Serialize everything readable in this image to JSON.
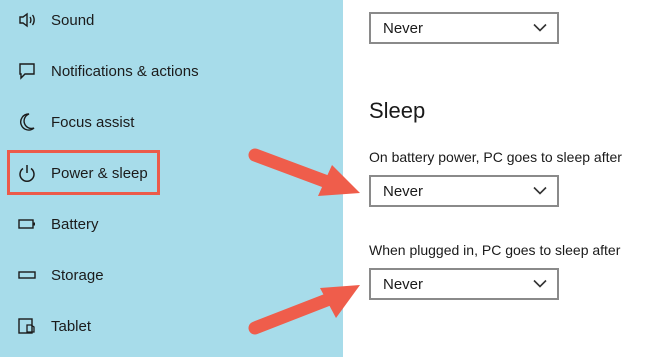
{
  "sidebar": {
    "items": [
      {
        "label": "Sound",
        "icon": "speaker-icon"
      },
      {
        "label": "Notifications & actions",
        "icon": "message-icon"
      },
      {
        "label": "Focus assist",
        "icon": "moon-icon"
      },
      {
        "label": "Power & sleep",
        "icon": "power-icon",
        "selected": true
      },
      {
        "label": "Battery",
        "icon": "battery-icon"
      },
      {
        "label": "Storage",
        "icon": "storage-icon"
      },
      {
        "label": "Tablet",
        "icon": "tablet-icon"
      }
    ]
  },
  "main": {
    "screen_select": {
      "value": "Never"
    },
    "sleep_heading": "Sleep",
    "battery_label": "On battery power, PC goes to sleep after",
    "battery_select": {
      "value": "Never"
    },
    "plugged_label": "When plugged in, PC goes to sleep after",
    "plugged_select": {
      "value": "Never"
    }
  },
  "colors": {
    "sidebar_bg": "#a7dcea",
    "highlight": "#ec5b4a",
    "arrow": "#ef5d4b"
  }
}
